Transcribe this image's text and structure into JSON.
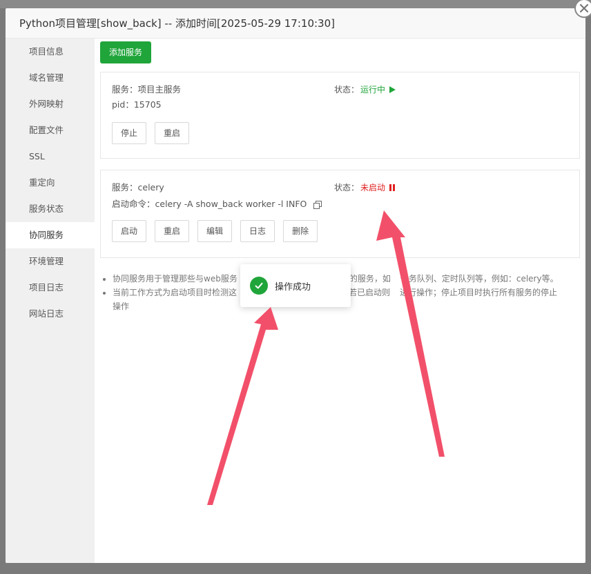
{
  "modal": {
    "title": "Python项目管理[show_back] -- 添加时间[2025-05-29 17:10:30]"
  },
  "sidebar": {
    "items": [
      {
        "label": "项目信息"
      },
      {
        "label": "域名管理"
      },
      {
        "label": "外网映射"
      },
      {
        "label": "配置文件"
      },
      {
        "label": "SSL"
      },
      {
        "label": "重定向"
      },
      {
        "label": "服务状态"
      },
      {
        "label": "协同服务"
      },
      {
        "label": "环境管理"
      },
      {
        "label": "项目日志"
      },
      {
        "label": "网站日志"
      }
    ],
    "active": "协同服务"
  },
  "toolbar": {
    "add_label": "添加服务"
  },
  "services": [
    {
      "service_line": "服务：项目主服务",
      "info_line": "pid：15705",
      "status_label": "状态：",
      "status_value": "运行中",
      "buttons": [
        "停止",
        "重启"
      ]
    },
    {
      "service_line": "服务：celery",
      "info_line": "启动命令：celery -A show_back worker -l INFO",
      "status_label": "状态：",
      "status_value": "未启动",
      "buttons": [
        "启动",
        "重启",
        "编辑",
        "日志",
        "删除"
      ]
    }
  ],
  "tips": [
    "协同服务用于管理那些与web服务",
    "务的服务，如",
    "任务队列、定时队列等，例如：celery等。",
    "当前工作方式为启动项目时检测这",
    "，若已启动则",
    "进行操作；停止项目时执行所有服务的停止",
    "操作"
  ],
  "toast": {
    "message": "操作成功"
  },
  "colors": {
    "accent": "#20a53a",
    "danger": "#e02020",
    "arrow": "#f2506a"
  }
}
